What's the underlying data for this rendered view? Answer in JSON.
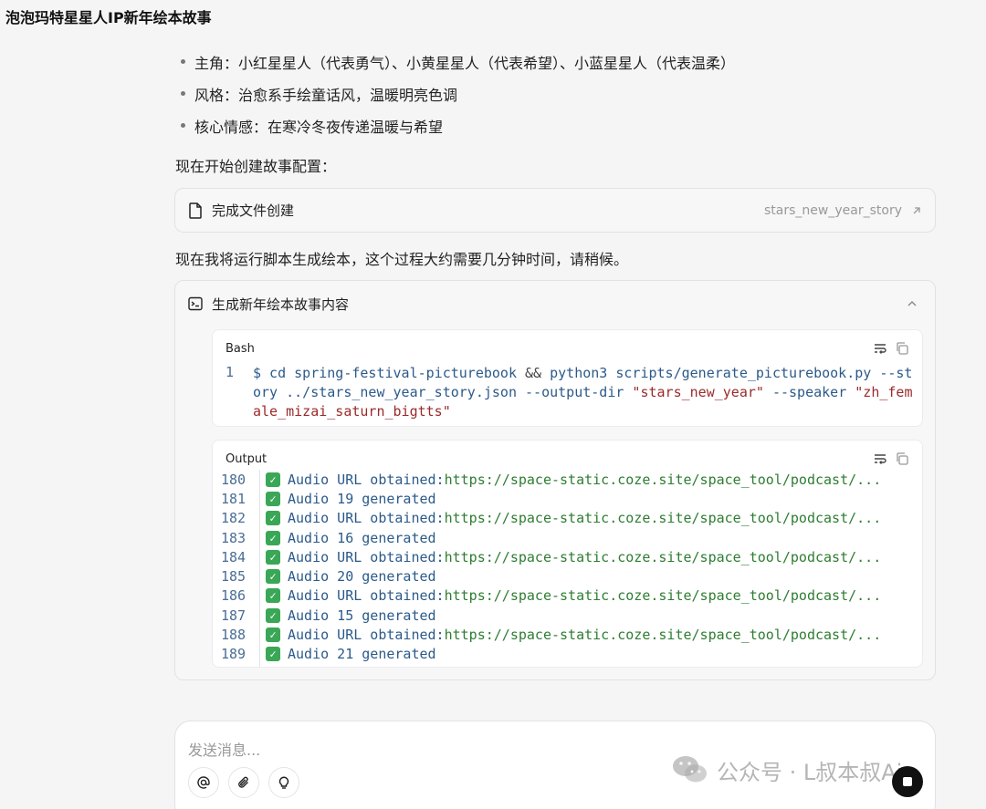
{
  "header": {
    "title": "泡泡玛特星星人IP新年绘本故事"
  },
  "bullets": [
    {
      "label": "主角：",
      "text": "小红星星人（代表勇气）、小黄星星人（代表希望）、小蓝星星人（代表温柔）"
    },
    {
      "label": "风格：",
      "text": "治愈系手绘童话风，温暖明亮色调"
    },
    {
      "label": "核心情感：",
      "text": "在寒冷冬夜传递温暖与希望"
    }
  ],
  "para1": "现在开始创建故事配置：",
  "file_card": {
    "label": "完成文件创建",
    "filename": "stars_new_year_story",
    "icon": "document-icon"
  },
  "para2": "现在我将运行脚本生成绘本，这个过程大约需要几分钟时间，请稍候。",
  "tool_card": {
    "title": "生成新年绘本故事内容",
    "icon": "terminal-icon",
    "bash": {
      "label": "Bash",
      "line_number": "1",
      "cmd_part1": "$ cd spring-festival-picturebook ",
      "op": "&&",
      "cmd_part2": " python3 scripts/generate_picturebook.py --story ../stars_new_year_story.json --output-dir ",
      "str1": "\"stars_new_year\"",
      "cmd_part3": " --speaker ",
      "str2": "\"zh_female_mizai_saturn_bigtts\""
    },
    "output": {
      "label": "Output",
      "lines": [
        {
          "num": "180",
          "text": "Audio URL obtained: ",
          "url": "https://space-static.coze.site/space_tool/podcast/..."
        },
        {
          "num": "181",
          "text": "Audio 19 generated",
          "url": ""
        },
        {
          "num": "182",
          "text": "Audio URL obtained: ",
          "url": "https://space-static.coze.site/space_tool/podcast/..."
        },
        {
          "num": "183",
          "text": "Audio 16 generated",
          "url": ""
        },
        {
          "num": "184",
          "text": "Audio URL obtained: ",
          "url": "https://space-static.coze.site/space_tool/podcast/..."
        },
        {
          "num": "185",
          "text": "Audio 20 generated",
          "url": ""
        },
        {
          "num": "186",
          "text": "Audio URL obtained: ",
          "url": "https://space-static.coze.site/space_tool/podcast/..."
        },
        {
          "num": "187",
          "text": "Audio 15 generated",
          "url": ""
        },
        {
          "num": "188",
          "text": "Audio URL obtained: ",
          "url": "https://space-static.coze.site/space_tool/podcast/..."
        },
        {
          "num": "189",
          "text": "Audio 21 generated",
          "url": ""
        }
      ]
    }
  },
  "composer": {
    "placeholder": "发送消息...",
    "tools": [
      "at-icon",
      "paperclip-icon",
      "lightbulb-icon"
    ]
  },
  "watermark": "公众号 · L叔本叔Ai",
  "colors": {
    "background": "#f5f5f6",
    "code_blue": "#2b5a8a",
    "code_green": "#2e7d32",
    "code_red": "#9a2a2a"
  }
}
